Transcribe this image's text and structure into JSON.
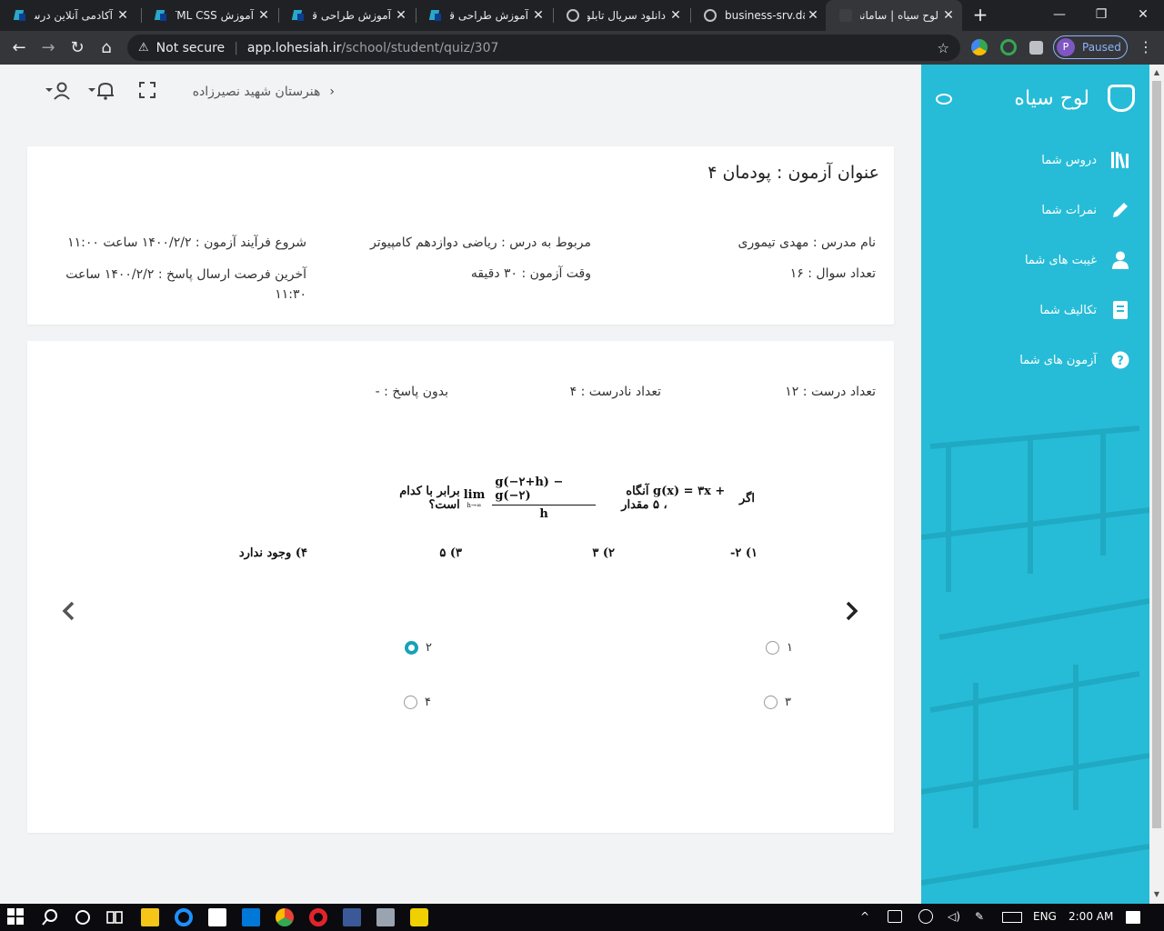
{
  "browser": {
    "tabs": [
      {
        "title": "آکادمی آنلاین درس",
        "favicon": "site-logo-icon",
        "active": false
      },
      {
        "title": "آموزش HTML CSS",
        "favicon": "site-logo-icon",
        "active": false
      },
      {
        "title": "آموزش طراحی قالب",
        "favicon": "site-logo-icon",
        "active": false
      },
      {
        "title": "آموزش طراحی قالب",
        "favicon": "site-logo-icon",
        "active": false
      },
      {
        "title": "دانلود سریال تابلو",
        "favicon": "globe-icon",
        "active": false
      },
      {
        "title": "business-srv.dar",
        "favicon": "globe-icon",
        "active": false
      },
      {
        "title": "لوح سیاه | سامانه",
        "favicon": "site-dark-icon",
        "active": true
      }
    ],
    "tab_close_glyph": "✕",
    "new_tab_glyph": "+",
    "window_controls": {
      "minimize": "—",
      "maximize": "❐",
      "close": "✕"
    },
    "nav": {
      "back": "←",
      "forward": "→",
      "reload": "↻",
      "home": "⌂"
    },
    "omnibox": {
      "warning_glyph": "⚠",
      "not_secure": "Not secure",
      "host": "app.lohesiah.ir",
      "path": "/school/student/quiz/307",
      "star_glyph": "☆"
    },
    "profile": {
      "initial": "P",
      "status": "Paused"
    },
    "menu_glyph": "⋮"
  },
  "header": {
    "school_name": "هنرستان شهید نصیرزاده",
    "chevron": "‹",
    "icons": [
      "user-icon",
      "bell-icon",
      "fullscreen-icon"
    ]
  },
  "sidebar": {
    "brand": "لوح سیاه",
    "items": [
      {
        "label": "دروس شما",
        "icon": "books-icon"
      },
      {
        "label": "نمرات شما",
        "icon": "pencil-icon"
      },
      {
        "label": "غیبت های شما",
        "icon": "user-icon"
      },
      {
        "label": "تکالیف شما",
        "icon": "notebook-icon"
      },
      {
        "label": "آزمون های شما",
        "icon": "question-icon"
      }
    ]
  },
  "quiz_info": {
    "title": "عنوان آزمون : پودمان ۴",
    "teacher": "نام مدرس : مهدی تیموری",
    "lesson": "مربوط به درس : ریاضی دوازدهم کامپیوتر",
    "start": "شروع فرآیند آزمون : ۱۴۰۰/۲/۲ ساعت ۱۱:۰۰",
    "question_count": "تعداد سوال : ۱۶",
    "duration": "وقت آزمون : ۳۰ دقیقه",
    "deadline": "آخرین فرصت ارسال پاسخ : ۱۴۰۰/۲/۲ ساعت ۱۱:۳۰"
  },
  "quiz_stats": {
    "correct": "تعداد درست : ۱۲",
    "wrong": "تعداد نادرست : ۴",
    "unanswered": "بدون پاسخ : -"
  },
  "question": {
    "prefix": "اگر",
    "function": "g(x) = ۳x + ۵ ،",
    "middle": "آنگاه مقدار",
    "numerator": "g(−۲+h) − g(−۲)",
    "denominator": "h",
    "lim": "lim",
    "lim_under": "h→∞",
    "suffix": "برابر با کدام است؟",
    "options": [
      "۱) ۲-",
      "۲) ۳",
      "۳) ۵",
      "۴) وجود ندارد"
    ]
  },
  "answers": {
    "choices": [
      {
        "label": "۱",
        "checked": false
      },
      {
        "label": "۲",
        "checked": true
      },
      {
        "label": "۳",
        "checked": false
      },
      {
        "label": "۴",
        "checked": false
      }
    ],
    "prev_glyph": "‹",
    "next_glyph": "›"
  },
  "taskbar": {
    "lang": "ENG",
    "time": "2:00 AM"
  },
  "colors": {
    "sidebar": "#26bcd7",
    "accent": "#17a2b8",
    "chrome_dark": "#202124",
    "chrome_toolbar": "#35363a"
  }
}
